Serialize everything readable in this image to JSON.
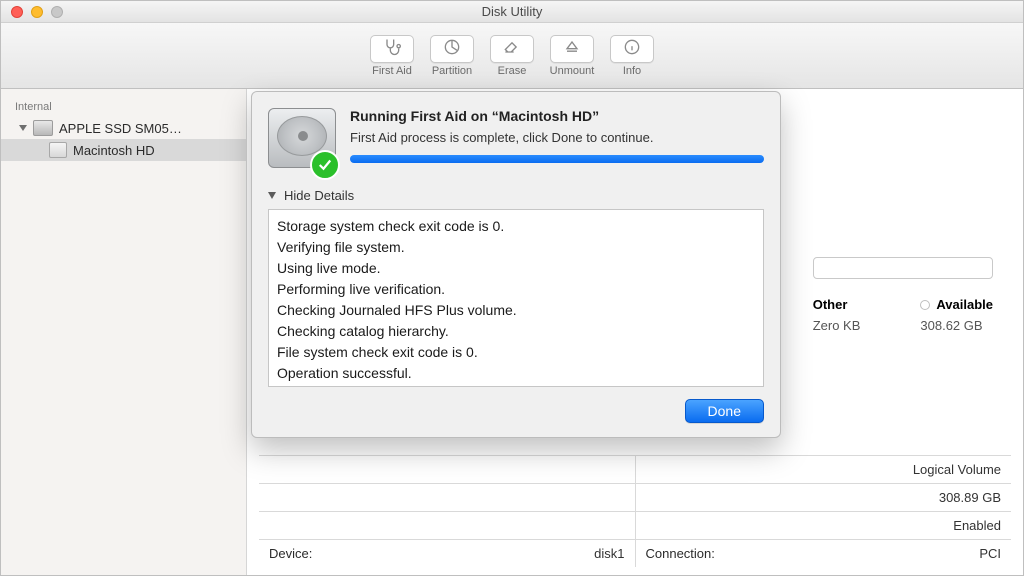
{
  "window": {
    "title": "Disk Utility"
  },
  "toolbar": [
    {
      "id": "first-aid",
      "label": "First Aid"
    },
    {
      "id": "partition",
      "label": "Partition"
    },
    {
      "id": "erase",
      "label": "Erase"
    },
    {
      "id": "unmount",
      "label": "Unmount"
    },
    {
      "id": "info",
      "label": "Info"
    }
  ],
  "sidebar": {
    "section": "Internal",
    "items": [
      {
        "label": "APPLE SSD SM05…"
      },
      {
        "label": "Macintosh HD"
      }
    ]
  },
  "stats": {
    "other": {
      "label": "Other",
      "value": "Zero KB"
    },
    "available": {
      "label": "Available",
      "value": "308.62 GB"
    }
  },
  "info_rows": [
    {
      "left_label": "",
      "left_value": "",
      "right_label": "",
      "right_value": "Logical Volume"
    },
    {
      "left_label": "",
      "left_value": "",
      "right_label": "",
      "right_value": "308.89 GB"
    },
    {
      "left_label": "",
      "left_value": "",
      "right_label": "",
      "right_value": "Enabled"
    },
    {
      "left_label": "Device:",
      "left_value": "disk1",
      "right_label": "Connection:",
      "right_value": "PCI"
    }
  ],
  "sheet": {
    "title": "Running First Aid on “Macintosh HD”",
    "subtitle": "First Aid process is complete, click Done to continue.",
    "toggle": "Hide Details",
    "log": [
      "Storage system check exit code is 0.",
      "Verifying file system.",
      "Using live mode.",
      "Performing live verification.",
      "Checking Journaled HFS Plus volume.",
      "Checking catalog hierarchy.",
      "File system check exit code is 0.",
      "Operation successful."
    ],
    "done": "Done",
    "progress_pct": 100
  }
}
